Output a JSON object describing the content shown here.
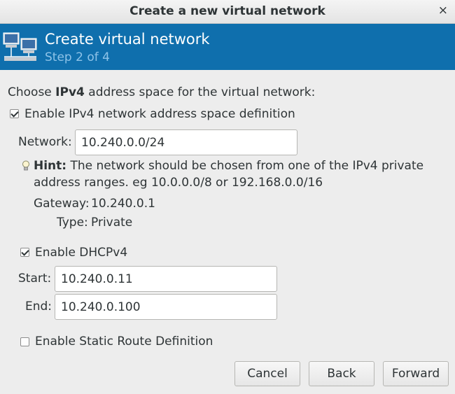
{
  "window": {
    "title": "Create a new virtual network",
    "close_glyph": "×"
  },
  "banner": {
    "title": "Create virtual network",
    "step": "Step 2 of 4",
    "icon": "network-computers-icon"
  },
  "intro": {
    "prefix": "Choose ",
    "bold": "IPv4",
    "suffix": " address space for the virtual network:"
  },
  "ipv4": {
    "enable_label": "Enable IPv4 network address space definition",
    "enabled": true,
    "network_label": "Network:",
    "network_value": "10.240.0.0/24",
    "hint_icon": "lightbulb-icon",
    "hint_bold": "Hint:",
    "hint_line1": " The network should be chosen from one of the IPv4 private",
    "hint_line2": "address ranges. eg 10.0.0.0/8 or 192.168.0.0/16",
    "gateway_label": "Gateway:",
    "gateway_value": "10.240.0.1",
    "type_label": "Type:",
    "type_value": "Private"
  },
  "dhcp": {
    "enable_label": "Enable DHCPv4",
    "enabled": true,
    "start_label": "Start:",
    "start_value": "10.240.0.11",
    "end_label": "End:",
    "end_value": "10.240.0.100"
  },
  "static_route": {
    "enable_label": "Enable Static Route Definition",
    "enabled": false
  },
  "buttons": {
    "cancel": "Cancel",
    "back": "Back",
    "forward": "Forward"
  },
  "colors": {
    "banner": "#0f6fad",
    "banner_subtitle": "#8ec3e8",
    "background": "#ededed"
  }
}
